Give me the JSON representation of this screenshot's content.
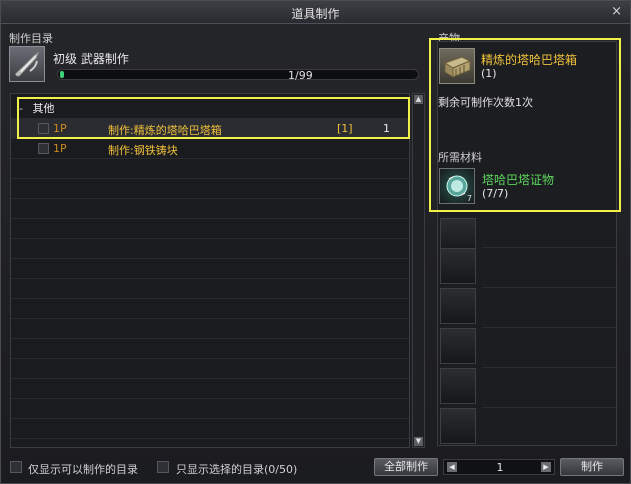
{
  "window": {
    "title": "道具制作",
    "close_glyph": "×"
  },
  "left": {
    "catalog_label": "制作目录",
    "recipe_title": "初级 武器制作",
    "progress": {
      "text": "1/99",
      "value": 1,
      "max": 99
    },
    "group": {
      "toggle": "-",
      "label": "其他"
    },
    "items": [
      {
        "level": "1P",
        "name": "制作:精炼的塔哈巴塔箱",
        "qty": "[1]",
        "count": "1"
      },
      {
        "level": "1P",
        "name": "制作:钢铁铸块",
        "qty": "",
        "count": ""
      }
    ]
  },
  "right": {
    "product_label": "产物",
    "product_name": "精炼的塔哈巴塔箱",
    "product_qty": "(1)",
    "remaining_text": "剩余可制作次数1次",
    "materials_label": "所需材料",
    "material_name": "塔哈巴塔证物",
    "material_qty": "(7/7)",
    "material_icon_count": "7"
  },
  "bottom": {
    "filter_craftable": "仅显示可以制作的目录",
    "filter_selected": "只显示选择的目录(0/50)",
    "craft_all_button": "全部制作",
    "quantity": "1",
    "step_left": "◀",
    "step_right": "▶",
    "craft_button": "制作"
  },
  "scrollbar": {
    "up": "▲",
    "down": "▼"
  },
  "colors": {
    "highlight": "#f2f04a",
    "item_name": "#f0c23a",
    "material_name": "#5bd65b",
    "progress": "#3fd07a"
  }
}
